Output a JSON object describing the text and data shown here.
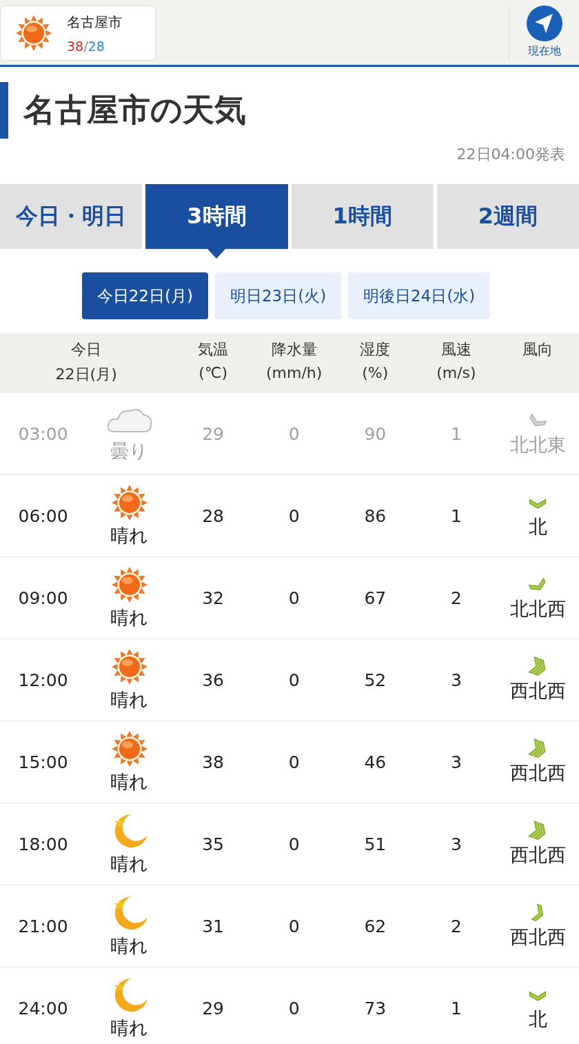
{
  "header": {
    "city": "名古屋市",
    "high": "38",
    "separator": "/",
    "low": "28",
    "location_button": "現在地"
  },
  "title": "名古屋市の天気",
  "published": "22日04:00発表",
  "tabs": [
    {
      "label": "今日・明日",
      "selected": false
    },
    {
      "label": "3時間",
      "selected": true
    },
    {
      "label": "1時間",
      "selected": false
    },
    {
      "label": "2週間",
      "selected": false
    }
  ],
  "days": [
    {
      "label": "今日22日(月)",
      "selected": true
    },
    {
      "label": "明日23日(火)",
      "selected": false
    },
    {
      "label": "明後日24日(水)",
      "selected": false
    }
  ],
  "table": {
    "columns": [
      [
        "今日",
        "22日(月)"
      ],
      [
        "気温",
        "(℃)"
      ],
      [
        "降水量",
        "(mm/h)"
      ],
      [
        "湿度",
        "(%)"
      ],
      [
        "風速",
        "(m/s)"
      ],
      [
        "風向"
      ]
    ],
    "rows": [
      {
        "time": "03:00",
        "kind": "cloud",
        "weather": "曇り",
        "temp": "29",
        "rain": "0",
        "humidity": "90",
        "wind_speed": "1",
        "wind": {
          "kind": "nne",
          "strong": false,
          "label": "北北東"
        },
        "past": true
      },
      {
        "time": "06:00",
        "kind": "sun",
        "weather": "晴れ",
        "temp": "28",
        "rain": "0",
        "humidity": "86",
        "wind_speed": "1",
        "wind": {
          "kind": "n",
          "strong": false,
          "label": "北"
        },
        "past": false
      },
      {
        "time": "09:00",
        "kind": "sun",
        "weather": "晴れ",
        "temp": "32",
        "rain": "0",
        "humidity": "67",
        "wind_speed": "2",
        "wind": {
          "kind": "nnw",
          "strong": false,
          "label": "北北西"
        },
        "past": false
      },
      {
        "time": "12:00",
        "kind": "sun",
        "weather": "晴れ",
        "temp": "36",
        "rain": "0",
        "humidity": "52",
        "wind_speed": "3",
        "wind": {
          "kind": "wnw",
          "strong": true,
          "label": "西北西"
        },
        "past": false
      },
      {
        "time": "15:00",
        "kind": "sun",
        "weather": "晴れ",
        "temp": "38",
        "rain": "0",
        "humidity": "46",
        "wind_speed": "3",
        "wind": {
          "kind": "wnw",
          "strong": true,
          "label": "西北西"
        },
        "past": false
      },
      {
        "time": "18:00",
        "kind": "moon",
        "weather": "晴れ",
        "temp": "35",
        "rain": "0",
        "humidity": "51",
        "wind_speed": "3",
        "wind": {
          "kind": "wnw",
          "strong": true,
          "label": "西北西"
        },
        "past": false
      },
      {
        "time": "21:00",
        "kind": "moon",
        "weather": "晴れ",
        "temp": "31",
        "rain": "0",
        "humidity": "62",
        "wind_speed": "2",
        "wind": {
          "kind": "wnw",
          "strong": false,
          "label": "西北西"
        },
        "past": false
      },
      {
        "time": "24:00",
        "kind": "moon",
        "weather": "晴れ",
        "temp": "29",
        "rain": "0",
        "humidity": "73",
        "wind_speed": "1",
        "wind": {
          "kind": "n",
          "strong": false,
          "label": "北"
        },
        "past": false
      }
    ]
  }
}
